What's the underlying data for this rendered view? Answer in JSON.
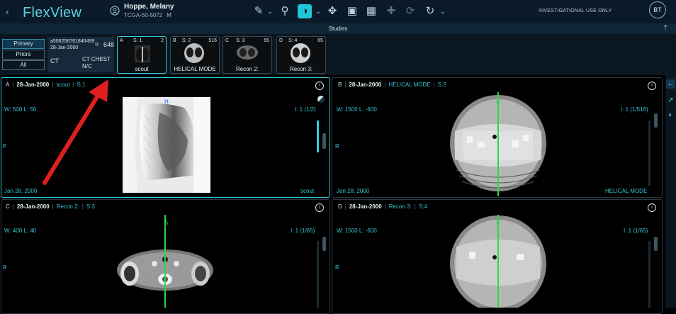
{
  "app": {
    "title": "FlexView",
    "back_icon": "chevron-left-icon"
  },
  "patient": {
    "name": "Hoppe, Melany",
    "id": "TCGA-50-5072",
    "sex": "M"
  },
  "toolbar": {
    "icons": [
      "ruler-icon",
      "chevron-down-icon",
      "zoom-icon",
      "contrast-icon",
      "chevron-down-icon",
      "pan-icon",
      "camera-icon",
      "layout-icon",
      "crosshair-icon",
      "sync-icon",
      "rotate-icon",
      "chevron-down-icon"
    ],
    "notice": "INVESTIGATIONAL USE ONLY",
    "avatar": "BT"
  },
  "studies": {
    "header": "Studies",
    "filters": [
      "Primary",
      "Priors",
      "All"
    ],
    "selected_filter": "Primary",
    "study": {
      "uid": "a508258761846499",
      "date": "28-Jan-2000",
      "count": "648",
      "modality": "CT",
      "description": "CT CHEST N/C"
    },
    "thumbnails": [
      {
        "letter": "A",
        "s": "S: 1",
        "n": "2",
        "label": "scout"
      },
      {
        "letter": "B",
        "s": "S: 2",
        "n": "516",
        "label": "HELICAL MODE"
      },
      {
        "letter": "C",
        "s": "S: 3",
        "n": "65",
        "label": "Recon 2:"
      },
      {
        "letter": "D",
        "s": "S: 4",
        "n": "65",
        "label": "Recon 3:"
      }
    ]
  },
  "viewports": [
    {
      "letter": "A",
      "date": "28-Jan-2000",
      "desc": "scout",
      "series": "S:1",
      "wl": "W: 500  L: 50",
      "img": "I: 1 (1/2)",
      "orient_top": "H",
      "orient_left": "P",
      "bottom_left": "Jan 28, 2000",
      "bottom_right": "scout"
    },
    {
      "letter": "B",
      "date": "28-Jan-2000",
      "desc": "HELICAL MODE",
      "series": "S:2",
      "wl": "W: 1500  L: -600",
      "img": "I: 1 (1/516)",
      "orient_top": "A",
      "orient_left": "R",
      "bottom_left": "Jan 28, 2000",
      "bottom_right": "HELICAL MODE"
    },
    {
      "letter": "C",
      "date": "28-Jan-2000",
      "desc": "Recon 2:",
      "series": "S:3",
      "wl": "W: 400  L: 40",
      "img": "I: 1 (1/65)",
      "orient_top": "A",
      "orient_left": "R"
    },
    {
      "letter": "D",
      "date": "28-Jan-2000",
      "desc": "Recon 3:",
      "series": "S:4",
      "wl": "W: 1500  L: -600",
      "img": "I: 1 (1/65)",
      "orient_top": "A",
      "orient_left": "R"
    }
  ],
  "colors": {
    "accent": "#2fd0e0",
    "annotation_arrow": "#e0201e",
    "reference_line": "#2ad84a"
  }
}
